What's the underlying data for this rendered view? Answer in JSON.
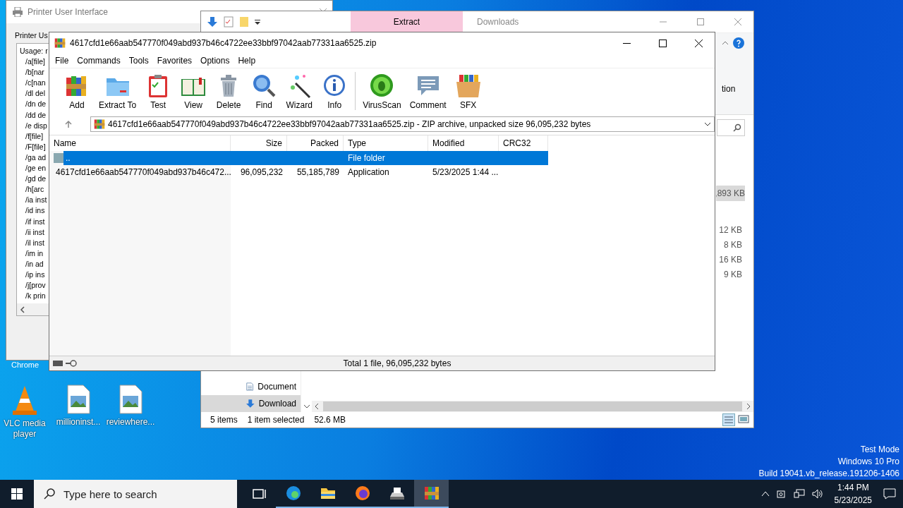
{
  "desktop": {
    "icons": [
      {
        "label": "VLC media player"
      },
      {
        "label": "millioninst..."
      },
      {
        "label": "reviewhere..."
      }
    ],
    "covered_label": "Chrome",
    "watermark": [
      "Test Mode",
      "Windows 10 Pro",
      "Build 19041.vb_release.191206-1406"
    ]
  },
  "printer_window": {
    "title": "Printer User Interface",
    "label": "Printer Us",
    "usage_lines": [
      "Usage: r",
      "/a[file]",
      "/b[nar",
      "/c[nan",
      "/dl del",
      "/dn de",
      "/dd de",
      "/e disp",
      "/f[file]",
      "/F[file]",
      "/ga ad",
      "/ge en",
      "/gd de",
      "/h[arc",
      "/ia inst",
      "/id ins",
      "/if inst",
      "/ii inst",
      "/il inst",
      "/im in",
      "/in ad",
      "/ip ins",
      "/j[prov",
      "/k prin"
    ]
  },
  "explorer_window": {
    "ribbon_tab": "Extract",
    "title": "Downloads",
    "ribbon_text": "tion",
    "highlighted_size": ",893 KB",
    "sizes": [
      "12 KB",
      "8 KB",
      "16 KB",
      "9 KB"
    ],
    "nav_items": [
      {
        "label": "Document",
        "selected": false
      },
      {
        "label": "Download",
        "selected": true
      }
    ],
    "status_bar": [
      "5 items",
      "1 item selected",
      "52.6 MB"
    ]
  },
  "archive_window": {
    "title": "4617cfd1e66aab547770f049abd937b46c4722ee33bbf97042aab77331aa6525.zip",
    "menu": [
      "File",
      "Commands",
      "Tools",
      "Favorites",
      "Options",
      "Help"
    ],
    "toolbar": [
      "Add",
      "Extract To",
      "Test",
      "View",
      "Delete",
      "Find",
      "Wizard",
      "Info",
      "VirusScan",
      "Comment",
      "SFX"
    ],
    "address": "4617cfd1e66aab547770f049abd937b46c4722ee33bbf97042aab77331aa6525.zip - ZIP archive, unpacked size 96,095,232 bytes",
    "columns": [
      "Name",
      "Size",
      "Packed",
      "Type",
      "Modified",
      "CRC32"
    ],
    "rows": [
      {
        "name": "..",
        "size": "",
        "packed": "",
        "type": "File folder",
        "modified": "",
        "kind": "folder",
        "selected": true
      },
      {
        "name": "4617cfd1e66aab547770f049abd937b46c472...",
        "size": "96,095,232",
        "packed": "55,185,789",
        "type": "Application",
        "modified": "5/23/2025 1:44 ...",
        "kind": "file",
        "selected": false
      }
    ],
    "status_bar": "Total 1 file, 96,095,232 bytes"
  },
  "taskbar": {
    "search": {
      "placeholder": "Type here to search"
    },
    "apps": [
      {
        "selected": false
      },
      {
        "selected": false
      },
      {
        "selected": false
      },
      {
        "selected": false
      },
      {
        "selected": true
      }
    ],
    "time": "1:44 PM",
    "date": "5/23/2025"
  }
}
